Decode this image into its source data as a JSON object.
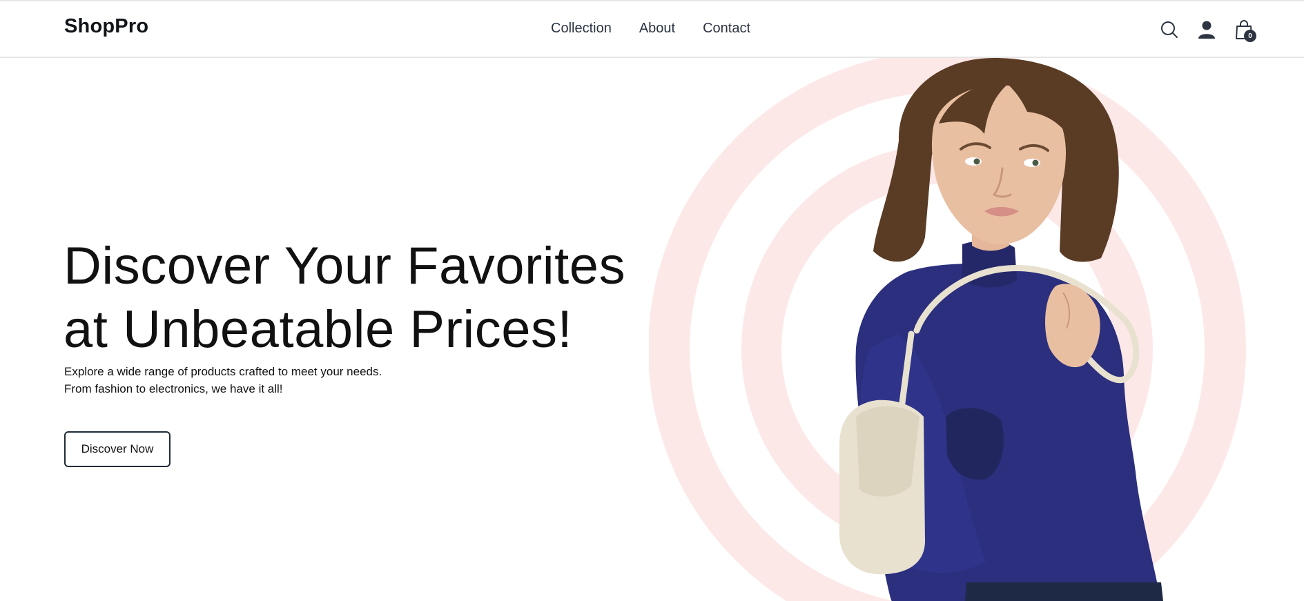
{
  "header": {
    "logo": "ShopPro",
    "nav": [
      {
        "label": "Collection"
      },
      {
        "label": "About"
      },
      {
        "label": "Contact"
      }
    ],
    "icons": {
      "search": "search-icon",
      "account": "user-icon",
      "cart": "shopping-bag-icon"
    },
    "cart_count": "0"
  },
  "hero": {
    "title_line1": "Discover Your Favorites",
    "title_line2": "at Unbeatable Prices!",
    "desc_line1": "Explore a wide range of products crafted to meet your needs.",
    "desc_line2": "From fashion to electronics, we have it all!",
    "cta": "Discover Now"
  },
  "colors": {
    "text": "#111418",
    "nav": "#2a3240",
    "ring": "#fde8e8",
    "blouse": "#2b2f7d",
    "bag": "#e8e1d0",
    "hair": "#5a3b24",
    "skin": "#e9bfa2"
  }
}
